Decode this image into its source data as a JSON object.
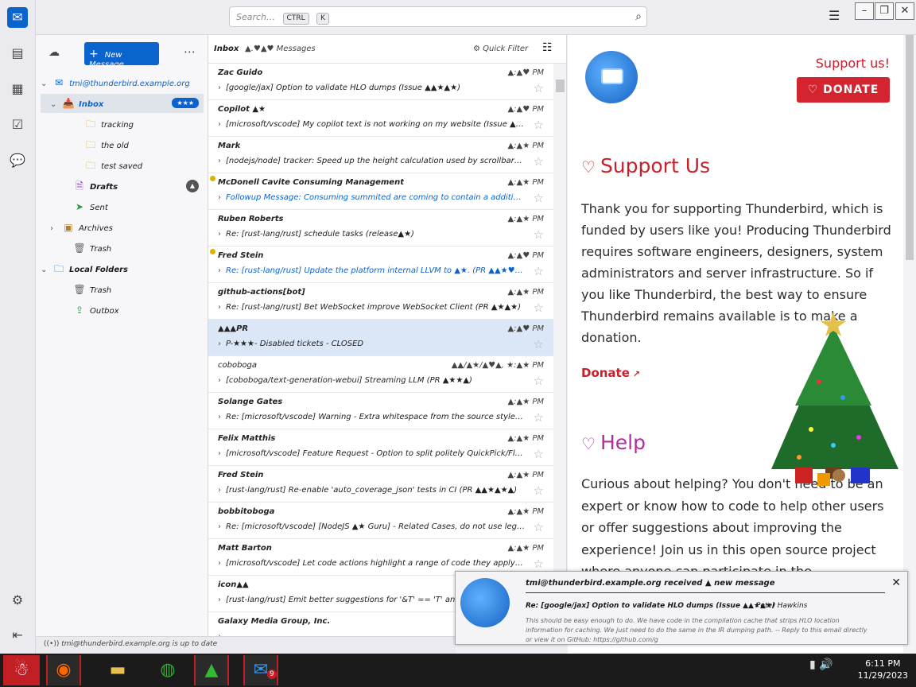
{
  "search": {
    "placeholder": "Search…",
    "key1": "CTRL",
    "key2": "K"
  },
  "folder_pane": {
    "new_message": "New Message",
    "account": "tmi@thunderbird.example.org",
    "folders": [
      {
        "label": "Inbox",
        "badge": "★★★"
      },
      {
        "label": "tracking"
      },
      {
        "label": "the old"
      },
      {
        "label": "test saved"
      },
      {
        "label": "Drafts",
        "badge": "▲"
      },
      {
        "label": "Sent"
      },
      {
        "label": "Archives"
      },
      {
        "label": "Trash"
      },
      {
        "label": "Local Folders"
      },
      {
        "label": "Trash"
      },
      {
        "label": "Outbox"
      }
    ]
  },
  "list_header": {
    "folder": "Inbox",
    "count": "▲.♥▲♥ Messages",
    "quick_filter": "Quick Filter"
  },
  "messages": [
    {
      "sender": "Zac Guido",
      "date": "▲:▲♥ PM",
      "subject": "[google/jax] Option to validate HLO dumps (Issue ▲▲★▲★)"
    },
    {
      "sender": "Copilot ▲★",
      "date": "▲:▲♥ PM",
      "subject": "[microsoft/vscode] My copilot text is not working on my website (Issue ▲♥♥★▲★)"
    },
    {
      "sender": "Mark",
      "date": "▲:▲★ PM",
      "subject": "[nodejs/node] tracker: Speed up the height calculation used by scrollbarProvider (PR ▲★♥★…"
    },
    {
      "sender": "McDonell Cavite Consuming Management",
      "date": "▲:▲★ PM",
      "subject": "Followup Message: Consuming summited are coming to contain a addition all Local Code RL SF…",
      "blue": true,
      "dot": true
    },
    {
      "sender": "Ruben Roberts",
      "date": "▲:▲★ PM",
      "subject": "Re: [rust-lang/rust] schedule tasks (release▲★)"
    },
    {
      "sender": "Fred Stein",
      "date": "▲:▲♥ PM",
      "subject": "Re: [rust-lang/rust] Update the platform internal LLVM to ▲★. (PR ▲▲★♥▲★)",
      "blue": true,
      "dot": true
    },
    {
      "sender": "github-actions[bot]",
      "date": "▲:▲★ PM",
      "subject": "Re: [rust-lang/rust] Bet WebSocket improve WebSocket Client (PR ▲★▲★)"
    },
    {
      "sender": "▲▲▲PR",
      "date": "▲:▲♥ PM",
      "subject": "P-★★★- Disabled tickets - CLOSED",
      "selected": true
    },
    {
      "sender": "coboboga",
      "date": "▲▲/▲★/▲♥▲, ★:▲★ PM",
      "subject": "[coboboga/text-generation-webui] Streaming LLM (PR ▲★★▲)",
      "light": true
    },
    {
      "sender": "Solange Gates",
      "date": "▲:▲★ PM",
      "subject": "Re: [microsoft/vscode] Warning - Extra whitespace from the source style (Discussion ▲★★★▲)"
    },
    {
      "sender": "Felix Matthis",
      "date": "▲:▲★ PM",
      "subject": "[microsoft/vscode] Feature Request - Option to split politely QuickPick/Flow description text to Cl…"
    },
    {
      "sender": "Fred Stein",
      "date": "▲:▲★ PM",
      "subject": "[rust-lang/rust] Re-enable 'auto_coverage_json' tests in CI (PR ▲▲★▲★▲)"
    },
    {
      "sender": "bobbitoboga",
      "date": "▲:▲★ PM",
      "subject": "Re: [microsoft/vscode] [NodeJS ▲★ Guru] - Related Cases, do not use legacy mock. dependency…"
    },
    {
      "sender": "Matt Barton",
      "date": "▲:▲★ PM",
      "subject": "[microsoft/vscode] Let code actions highlight a range of code they apply to (Issue ▲♥♥▲★)"
    },
    {
      "sender": "icon▲▲",
      "date": "▲:▲★ PM",
      "subject": "[rust-lang/rust] Emit better suggestions for '&T' == 'T' and '&T' == '&T' (PR…"
    },
    {
      "sender": "Galaxy Media Group, Inc.",
      "date": "",
      "subject": ""
    }
  ],
  "content": {
    "support_link": "Support us!",
    "donate_button": "DONATE",
    "support_heading": "Support Us",
    "support_text": "Thank you for supporting Thunderbird, which is funded by users like you! Producing Thunderbird requires software engineers, designers, system administrators and server infrastructure. So if you like Thunderbird, the best way to ensure Thunderbird remains available is to make a donation.",
    "donate_link": "Donate",
    "help_heading": "Help",
    "help_text": "Curious about helping? You don't need to be an expert or know how to code to help other users or offer suggestions about improving the experience! Join us in this open source project where anyone can participate in the"
  },
  "status": {
    "text": "tmi@thunderbird.example.org is up to date"
  },
  "notification": {
    "title": "tmi@thunderbird.example.org received ▲ new message",
    "subject": "Re: [google/jax] Option to validate HLO dumps (Issue ▲▲★▲★)",
    "author": "Peter Hawkins",
    "body": "This should be easy enough to do. We have code in the compilation cache that strips HLO location information for caching. We just need to do the same in the IR dumping path. -- Reply to this email directly or view it on GitHub: https://github.com/g"
  },
  "taskbar": {
    "time": "6:11 PM",
    "date": "11/29/2023",
    "badge": "9"
  },
  "colors": {
    "accent": "#0b63ce",
    "donate": "#d3242f",
    "help": "#b02fa0"
  }
}
